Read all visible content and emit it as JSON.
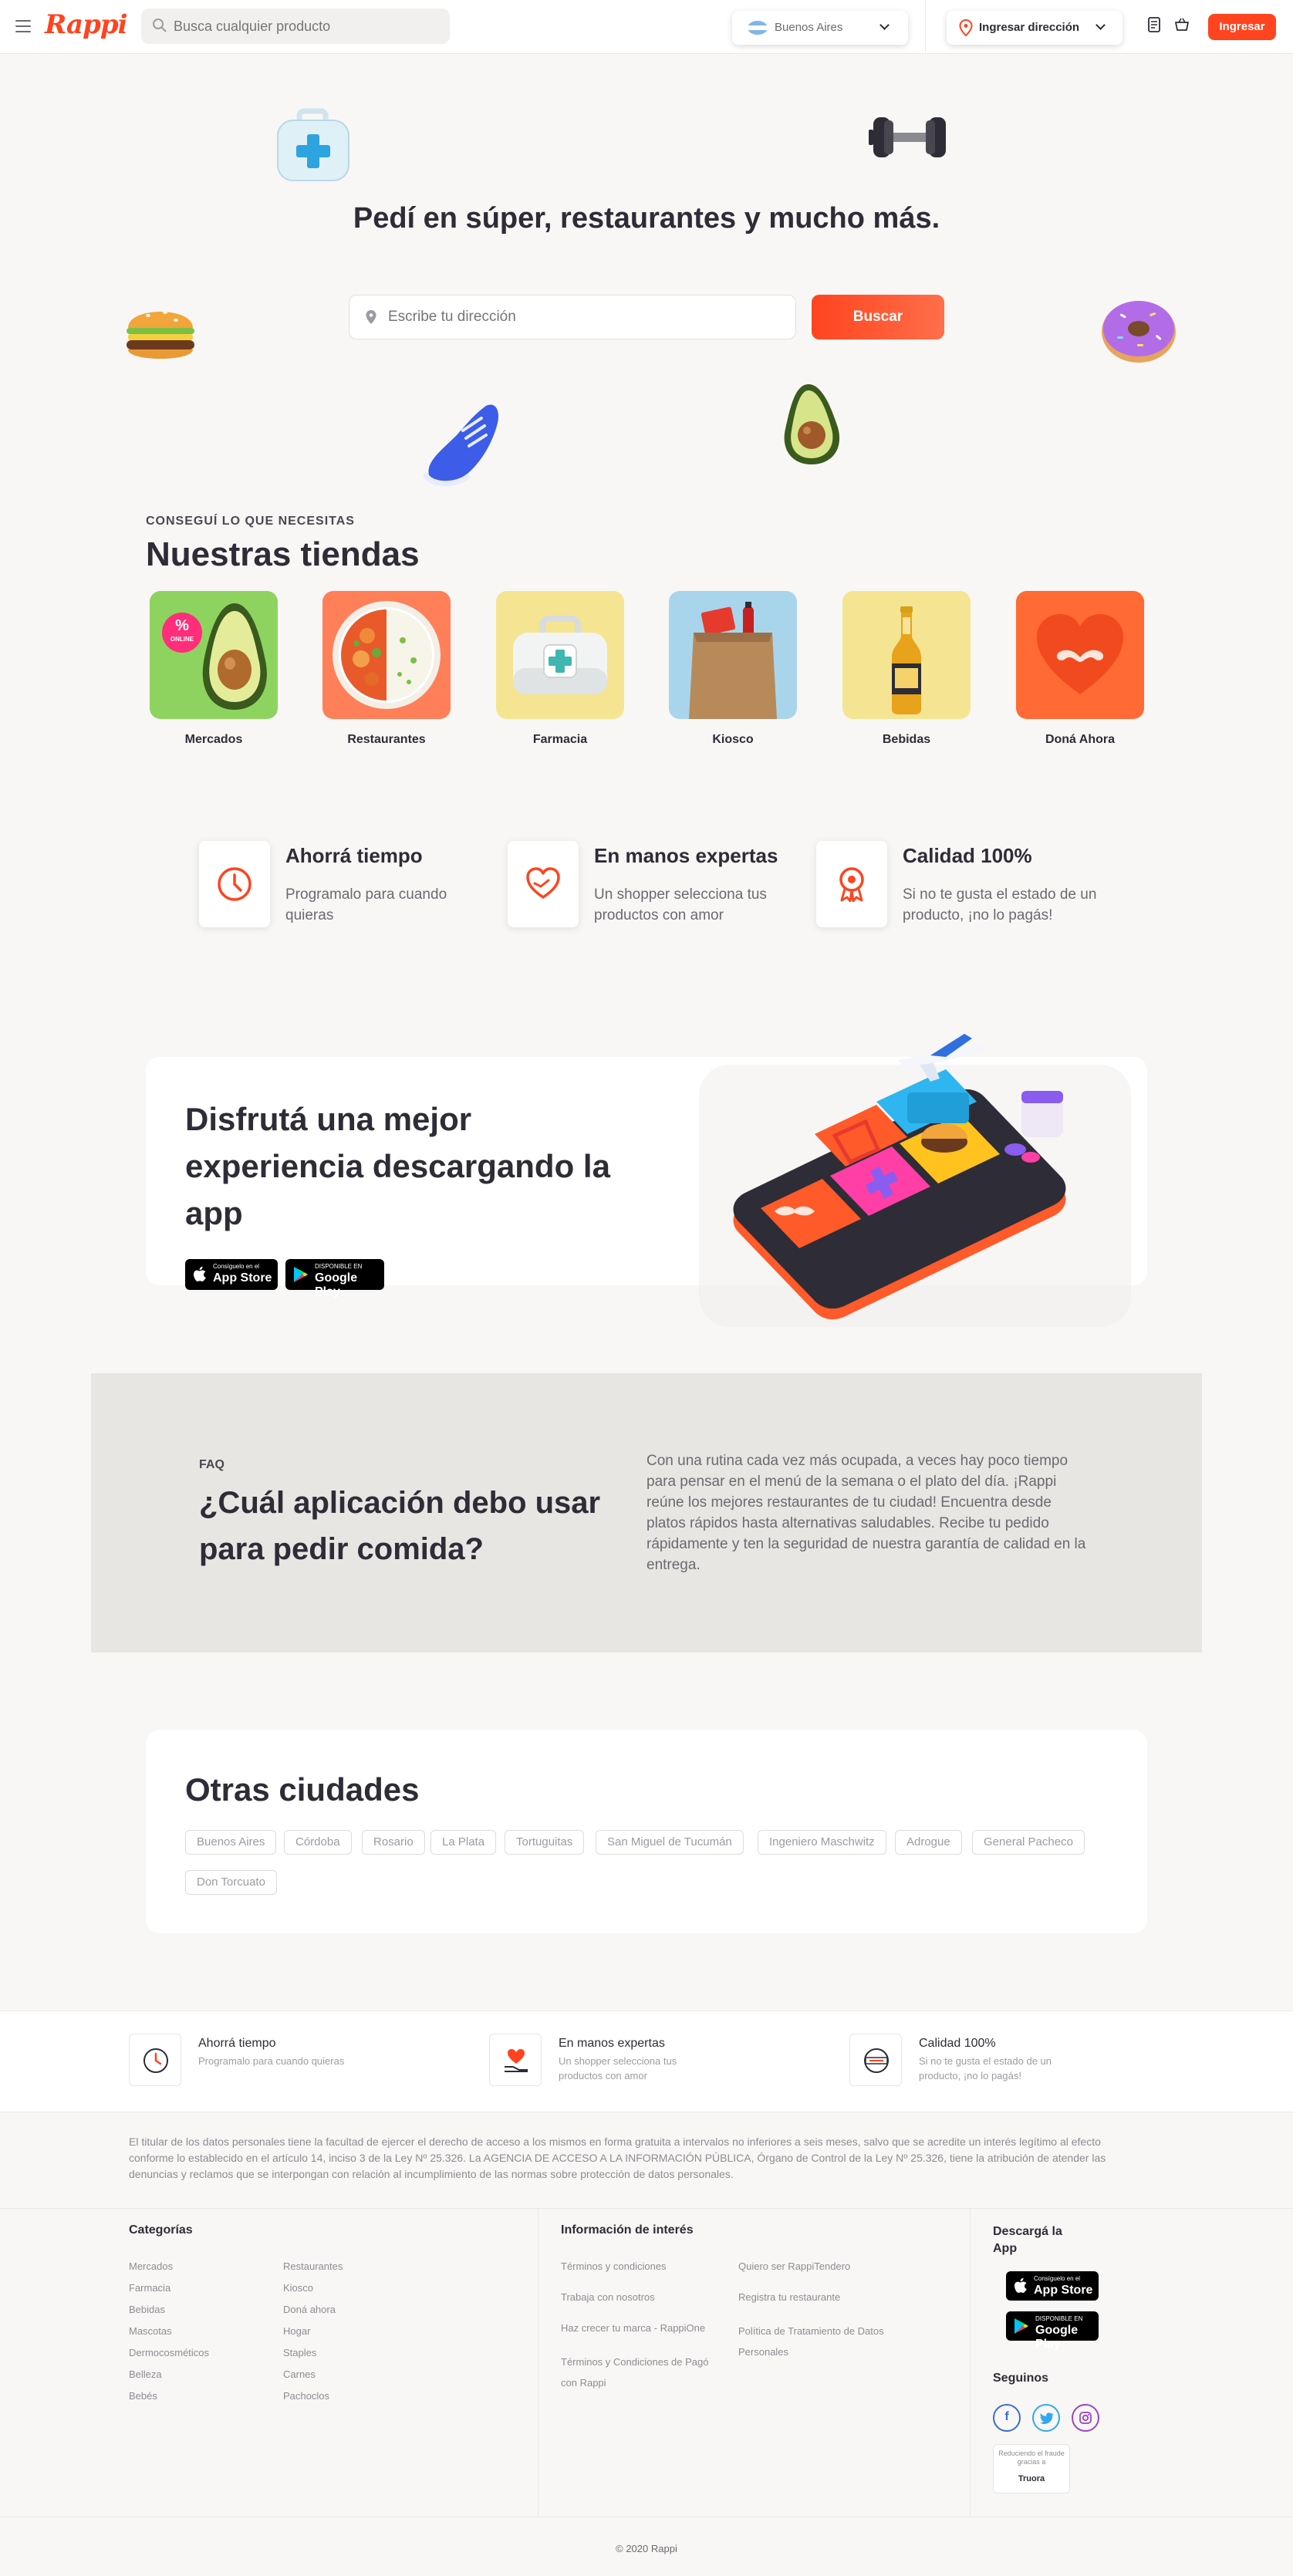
{
  "header": {
    "logo": "Rappi",
    "search_placeholder": "Busca cualquier producto",
    "city": "Buenos Aires",
    "address_button": "Ingresar dirección",
    "login_button": "Ingresar"
  },
  "hero": {
    "title": "Pedí en súper, restaurantes y mucho más.",
    "address_placeholder": "Escribe tu dirección",
    "search_button": "Buscar"
  },
  "stores": {
    "eyebrow": "CONSEGUÍ LO QUE NECESITAS",
    "title": "Nuestras tiendas",
    "badge_percent": "%",
    "badge_text": "ONLINE",
    "items": [
      {
        "label": "Mercados",
        "bg": "#8ed35f"
      },
      {
        "label": "Restaurantes",
        "bg": "#ff7f59"
      },
      {
        "label": "Farmacia",
        "bg": "#f5e592"
      },
      {
        "label": "Kiosco",
        "bg": "#a9d5ec"
      },
      {
        "label": "Bebidas",
        "bg": "#f5e592"
      },
      {
        "label": "Doná Ahora",
        "bg": "#ff6a35"
      }
    ]
  },
  "features": [
    {
      "title": "Ahorrá tiempo",
      "desc": "Programalo para cuando quieras",
      "icon": "clock-icon"
    },
    {
      "title": "En manos expertas",
      "desc": "Un shopper selecciona tus productos con amor",
      "icon": "heart-hand-icon"
    },
    {
      "title": "Calidad 100%",
      "desc": "Si no te gusta el estado de un producto, ¡no lo pagás!",
      "icon": "medal-icon"
    }
  ],
  "app_promo": {
    "title": "Disfrutá una mejor experiencia descargando la app",
    "appstore_small": "Consíguelo en el",
    "appstore_big": "App Store",
    "googleplay_small": "DISPONIBLE EN",
    "googleplay_big": "Google Play"
  },
  "faq": {
    "eyebrow": "FAQ",
    "question": "¿Cuál aplicación debo usar para pedir comida?",
    "answer": "Con una rutina cada vez más ocupada, a veces hay poco tiempo para pensar en el menú de la semana o el plato del día. ¡Rappi reúne los mejores restaurantes de tu ciudad! Encuentra desde platos rápidos hasta alternativas saludables. Recibe tu pedido rápidamente y ten la seguridad de nuestra garantía de calidad en la entrega."
  },
  "cities": {
    "title": "Otras ciudades",
    "items": [
      "Buenos Aires",
      "Córdoba",
      "Rosario",
      "La Plata",
      "Tortuguitas",
      "San Miguel de Tucumán",
      "Ingeniero Maschwitz",
      "Adrogue",
      "General Pacheco",
      "Don Torcuato"
    ]
  },
  "bottom_features": [
    {
      "title": "Ahorrá tiempo",
      "desc": "Programalo para cuando quieras"
    },
    {
      "title": "En manos expertas",
      "desc": "Un shopper selecciona tus productos con amor"
    },
    {
      "title": "Calidad 100%",
      "desc": "Si no te gusta el estado de un producto, ¡no lo pagás!"
    }
  ],
  "legal": "El titular de los datos personales tiene la facultad de ejercer el derecho de acceso a los mismos en forma gratuita a intervalos no inferiores a seis meses, salvo que se acredite un interés legítimo al efecto conforme lo establecido en el artículo 14, inciso 3 de la Ley Nº 25.326. La AGENCIA DE ACCESO A LA INFORMACIÓN PÚBLICA, Órgano de Control de la Ley Nº 25.326, tiene la atribución de atender las denuncias y reclamos que se interpongan con relación al incumplimiento de las normas sobre protección de datos personales.",
  "footer": {
    "categories_title": "Categorías",
    "categories_col1": [
      "Mercados",
      "Farmacia",
      "Bebidas",
      "Mascotas",
      "Dermocosméticos",
      "Belleza",
      "Bebés"
    ],
    "categories_col2": [
      "Restaurantes",
      "Kiosco",
      "Doná ahora",
      "Hogar",
      "Staples",
      "Carnes",
      "Pachoclos"
    ],
    "info_title": "Información de interés",
    "info_col1": [
      "Términos y condiciones",
      "Trabaja con nosotros",
      "Haz crecer tu marca - RappiOne",
      "Términos y Condiciones de Pagó con Rappi"
    ],
    "info_col2": [
      "Quiero ser RappiTendero",
      "Registra tu restaurante",
      "Política de Tratamiento de Datos Personales"
    ],
    "download_title": "Descargá la App",
    "follow_title": "Seguinos",
    "fraud_text": "Reduciendo el fraude gracias a",
    "fraud_brand": "Truora",
    "copyright": "© 2020 Rappi"
  }
}
